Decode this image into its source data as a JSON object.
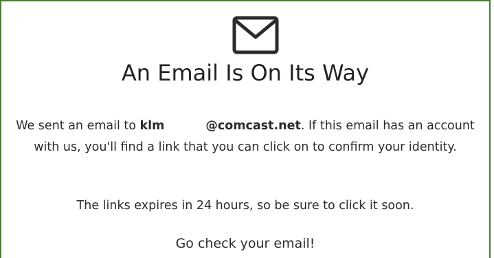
{
  "icon": "envelope-icon",
  "heading": "An Email Is On Its Way",
  "message": {
    "prefix": "We sent an email to ",
    "email_start": "klm",
    "email_domain": "@comcast.net",
    "suffix": ". If this email has an account with us, you'll find a link that you can click on to confirm your identity."
  },
  "expiry_text": "The links expires in 24 hours, so be sure to click it soon.",
  "cta_text": "Go check your email!",
  "colors": {
    "border": "#4a7a3a",
    "text": "#2b2b2b"
  }
}
